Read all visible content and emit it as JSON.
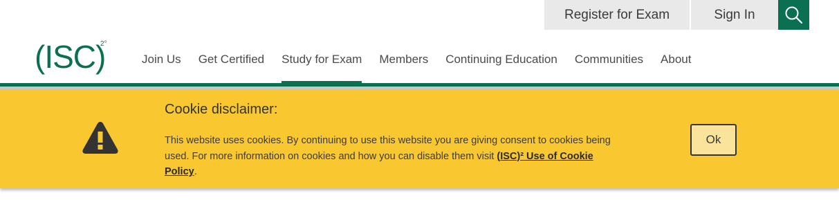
{
  "utility": {
    "register_label": "Register for Exam",
    "signin_label": "Sign In",
    "search_icon": "search-icon"
  },
  "logo": {
    "text": "(ISC)",
    "superscript": "2°"
  },
  "nav": {
    "items": [
      {
        "label": "Join Us"
      },
      {
        "label": "Get Certified"
      },
      {
        "label": "Study for Exam",
        "active": true
      },
      {
        "label": "Members"
      },
      {
        "label": "Continuing Education"
      },
      {
        "label": "Communities"
      },
      {
        "label": "About"
      }
    ]
  },
  "cookie": {
    "title": "Cookie disclaimer:",
    "body": "This website uses cookies. By continuing to use this website you are giving consent to cookies being used. For more information on cookies and how you can disable them visit ",
    "link_text": "(ISC)² Use of Cookie Policy",
    "trailing": ".",
    "ok_label": "Ok",
    "icon": "warning-icon"
  },
  "colors": {
    "brand_green": "#0b7052",
    "banner_yellow": "#f9c730",
    "ok_bg": "#fbe39a"
  }
}
